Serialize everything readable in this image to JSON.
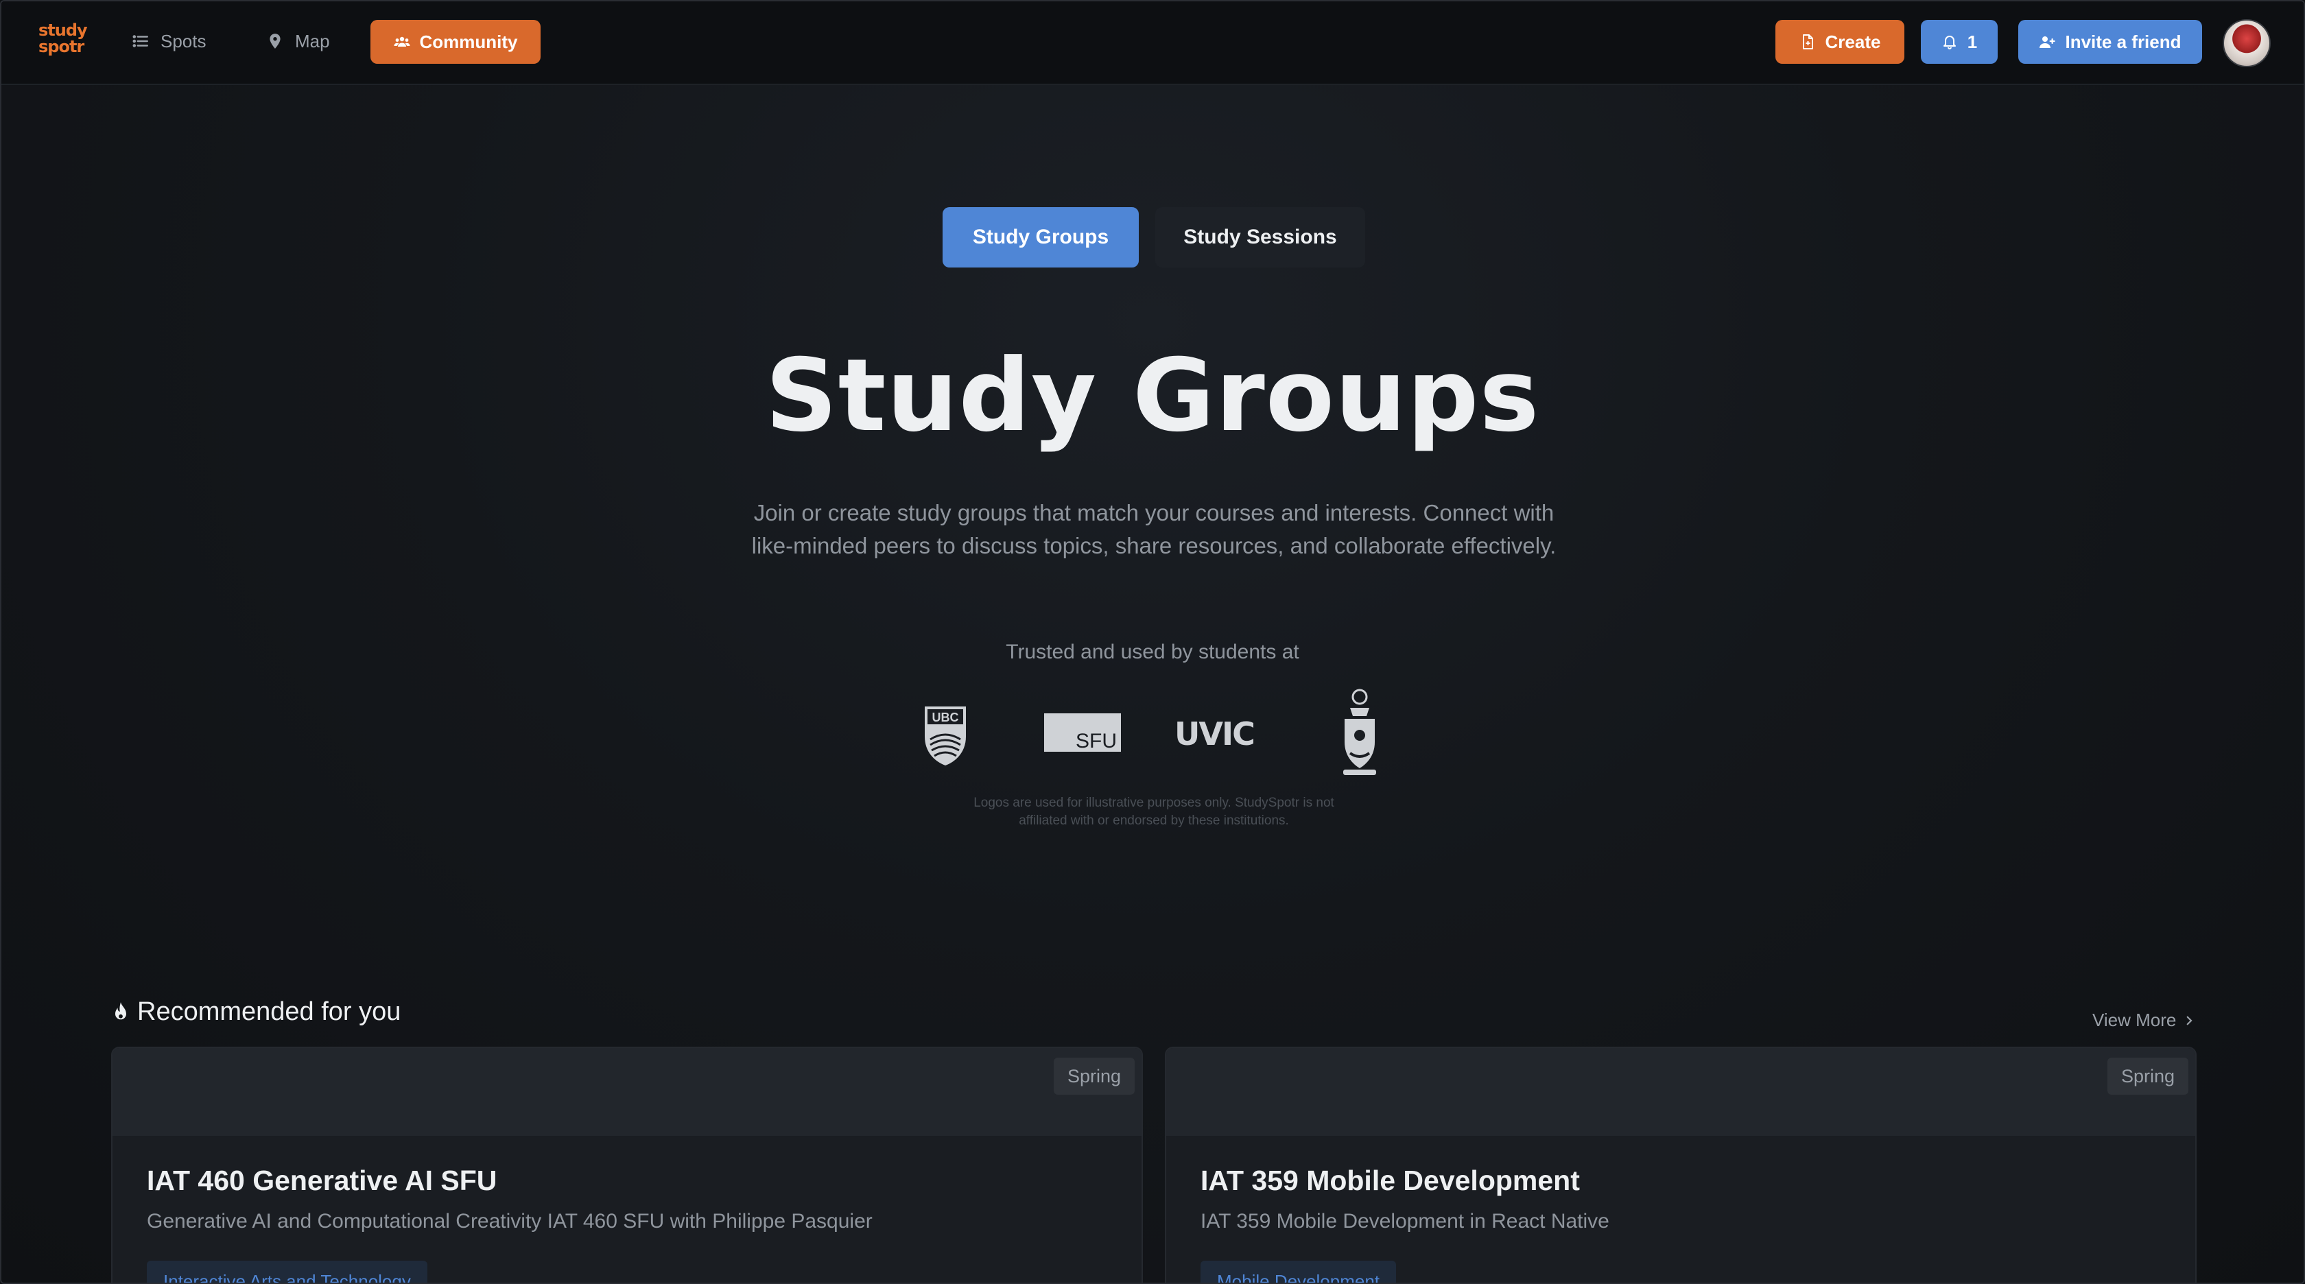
{
  "nav": {
    "logo_line1": "study",
    "logo_line2": "spotr",
    "spots": "Spots",
    "map": "Map",
    "community": "Community",
    "create": "Create",
    "notifications_count": "1",
    "invite": "Invite a friend"
  },
  "tabs": {
    "groups": "Study Groups",
    "sessions": "Study Sessions"
  },
  "hero": {
    "title": "Study Groups",
    "description_line1": "Join or create study groups that match your courses and interests. Connect with",
    "description_line2": "like-minded peers to discuss topics, share resources, and collaborate effectively."
  },
  "trusted": {
    "label": "Trusted and used by students at",
    "logos": [
      "UBC",
      "SFU",
      "UVIC",
      "University of Toronto crest"
    ],
    "disclaimer_line1": "Logos are used for illustrative purposes only. StudySpotr is not",
    "disclaimer_line2": "affiliated with or endorsed by these institutions."
  },
  "recommended": {
    "heading": "Recommended for you",
    "view_more": "View More",
    "cards": [
      {
        "season": "Spring",
        "title": "IAT 460 Generative AI SFU",
        "subtitle": "Generative AI and Computational Creativity IAT 460 SFU with Philippe Pasquier",
        "tag": "Interactive Arts and Technology"
      },
      {
        "season": "Spring",
        "title": "IAT 359 Mobile Development",
        "subtitle": "IAT 359 Mobile Development in React Native",
        "tag": "Mobile Development"
      }
    ]
  },
  "colors": {
    "accent_orange": "#d9692c",
    "accent_blue": "#4f86d6",
    "background": "#0f1114"
  }
}
